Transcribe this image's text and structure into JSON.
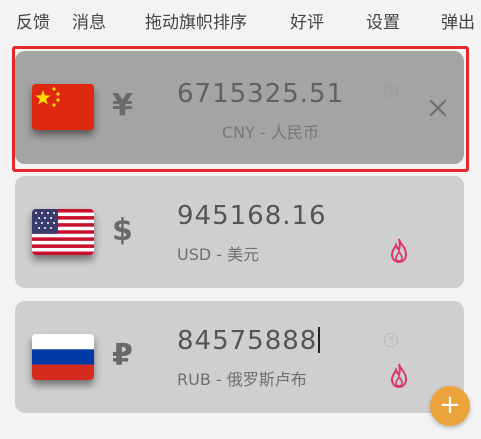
{
  "menu": {
    "feedback": "反馈",
    "messages": "消息",
    "sort_flags": "拖动旗帜排序",
    "rate": "好评",
    "settings": "设置",
    "eject": "弹出"
  },
  "cards": [
    {
      "flag_icon": "china-flag-icon",
      "symbol": "¥",
      "value": "6715325.51",
      "caption": "CNY - 人民币",
      "selected": true
    },
    {
      "flag_icon": "usa-flag-icon",
      "symbol": "$",
      "value": "945168.16",
      "caption": "USD - 美元",
      "popular_icon": "fire-icon"
    },
    {
      "flag_icon": "russia-flag-icon",
      "symbol": "₽",
      "value": "84575888",
      "caption": "RUB - 俄罗斯卢布",
      "popular_icon": "fire-icon"
    }
  ],
  "colors": {
    "selected_border": "#e4272a",
    "accent_fire": "#d9386b",
    "fab": "#eba43c"
  }
}
